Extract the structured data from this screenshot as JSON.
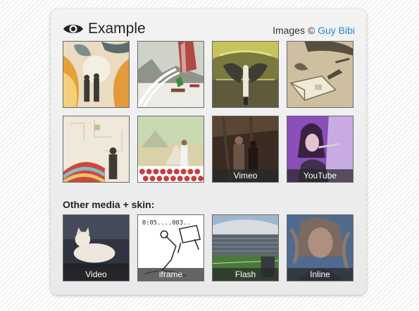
{
  "header": {
    "title": "Example",
    "credit_prefix": "Images ©",
    "credit_author": "Guy Bibi",
    "icon": "eye-icon"
  },
  "gallery": {
    "items": [
      {
        "caption": ""
      },
      {
        "caption": ""
      },
      {
        "caption": ""
      },
      {
        "caption": ""
      },
      {
        "caption": ""
      },
      {
        "caption": ""
      },
      {
        "caption": "Vimeo"
      },
      {
        "caption": "YouTube"
      }
    ]
  },
  "media": {
    "heading": "Other media + skin:",
    "items": [
      {
        "caption": "Video"
      },
      {
        "caption": "iframe"
      },
      {
        "caption": "Flash"
      },
      {
        "caption": "Inline"
      }
    ]
  },
  "colors": {
    "link": "#1e88d3",
    "caption_bg": "#282828"
  }
}
